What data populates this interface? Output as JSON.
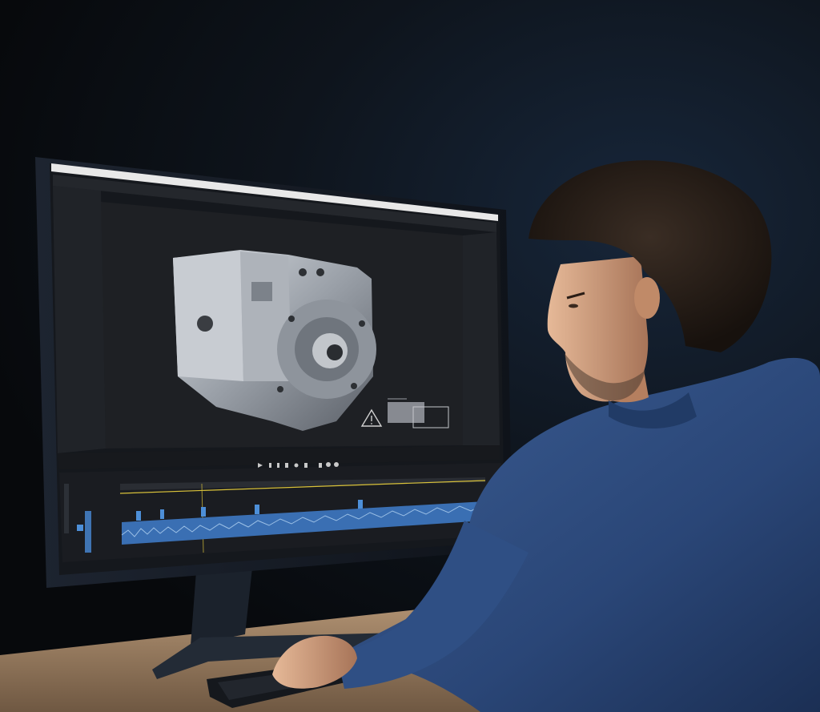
{
  "scene": {
    "description_colors": {
      "shirt": "#2d4a7a",
      "background": "#0b0e13",
      "desk": "#a08468",
      "screen_bg": "#1a1c20"
    }
  },
  "editor": {
    "icon_warning": "warning-icon",
    "icon_play": "play-icon",
    "playhead_color": "#d9c23a",
    "clip_color": "#4d8fd8",
    "waveform_color": "#9cc0e6"
  }
}
